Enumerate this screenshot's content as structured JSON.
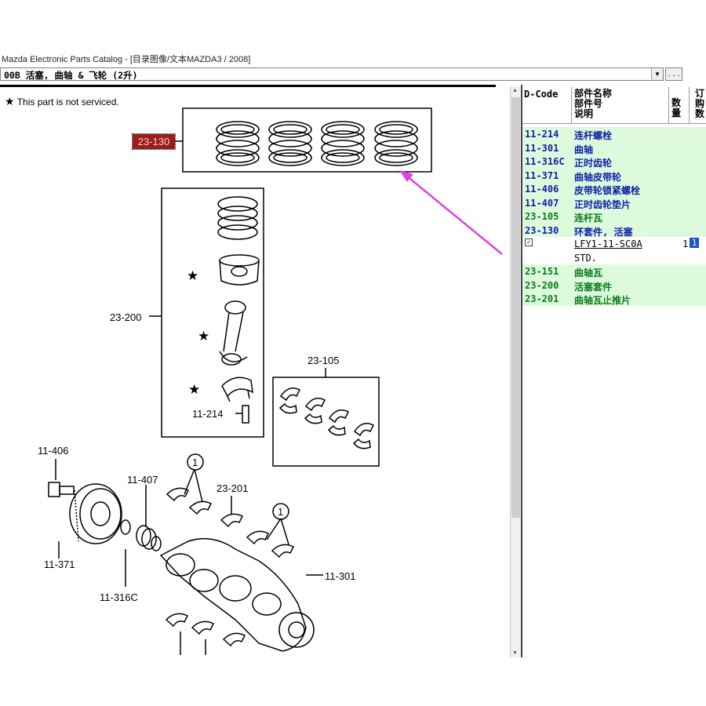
{
  "window": {
    "title": "Mazda Electronic Parts Catalog - [目录图像/文本MAZDA3 / 2008]"
  },
  "selector": {
    "value": "00B  活塞, 曲轴 & 飞轮 (2升)",
    "browse_label": ". . ."
  },
  "diagram": {
    "legend_star": "★",
    "legend_text": "This part is not serviced.",
    "callouts": {
      "rings_highlighted": "23-130",
      "piston_set": "23-200",
      "bearings": "23-105",
      "bolt": "11-214",
      "pulley_bolt": "11-406",
      "gear_washer": "11-407",
      "pulley": "11-371",
      "thrust_bearing": "23-201",
      "timing_gear": "11-316C",
      "crankshaft": "11-301",
      "circled_one_a": "1",
      "circled_one_b": "1"
    },
    "colors": {
      "highlight_bg": "#9b1c1c",
      "arrow": "#e040e0"
    }
  },
  "parts_table": {
    "headers": {
      "dcode": "D-Code",
      "name_lines": [
        "部件名称",
        "部件号",
        "说明"
      ],
      "qty_lines": [
        "数",
        "量"
      ],
      "order_lines": [
        "订",
        "购",
        "数"
      ]
    },
    "rows": [
      {
        "code": "11-214",
        "name": "连杆螺栓",
        "color": "blue"
      },
      {
        "code": "11-301",
        "name": "曲轴",
        "color": "blue"
      },
      {
        "code": "11-316C",
        "name": "正时齿轮",
        "color": "blue"
      },
      {
        "code": "11-371",
        "name": "曲轴皮带轮",
        "color": "blue"
      },
      {
        "code": "11-406",
        "name": "皮带轮锁紧螺栓",
        "color": "blue"
      },
      {
        "code": "11-407",
        "name": "正时齿轮垫片",
        "color": "blue"
      },
      {
        "code": "23-105",
        "name": "连杆瓦",
        "color": "green"
      },
      {
        "code": "23-130",
        "name": "环套件, 活塞",
        "color": "blue"
      }
    ],
    "selected_part": {
      "checked": "✓",
      "part_number": "LFY1-11-SC0A",
      "qty": "1",
      "order_qty": "1",
      "description": "STD."
    },
    "rows_after": [
      {
        "code": "23-151",
        "name": "曲轴瓦",
        "color": "green"
      },
      {
        "code": "23-200",
        "name": "活塞套件",
        "color": "green"
      },
      {
        "code": "23-201",
        "name": "曲轴瓦止推片",
        "color": "green"
      }
    ]
  }
}
